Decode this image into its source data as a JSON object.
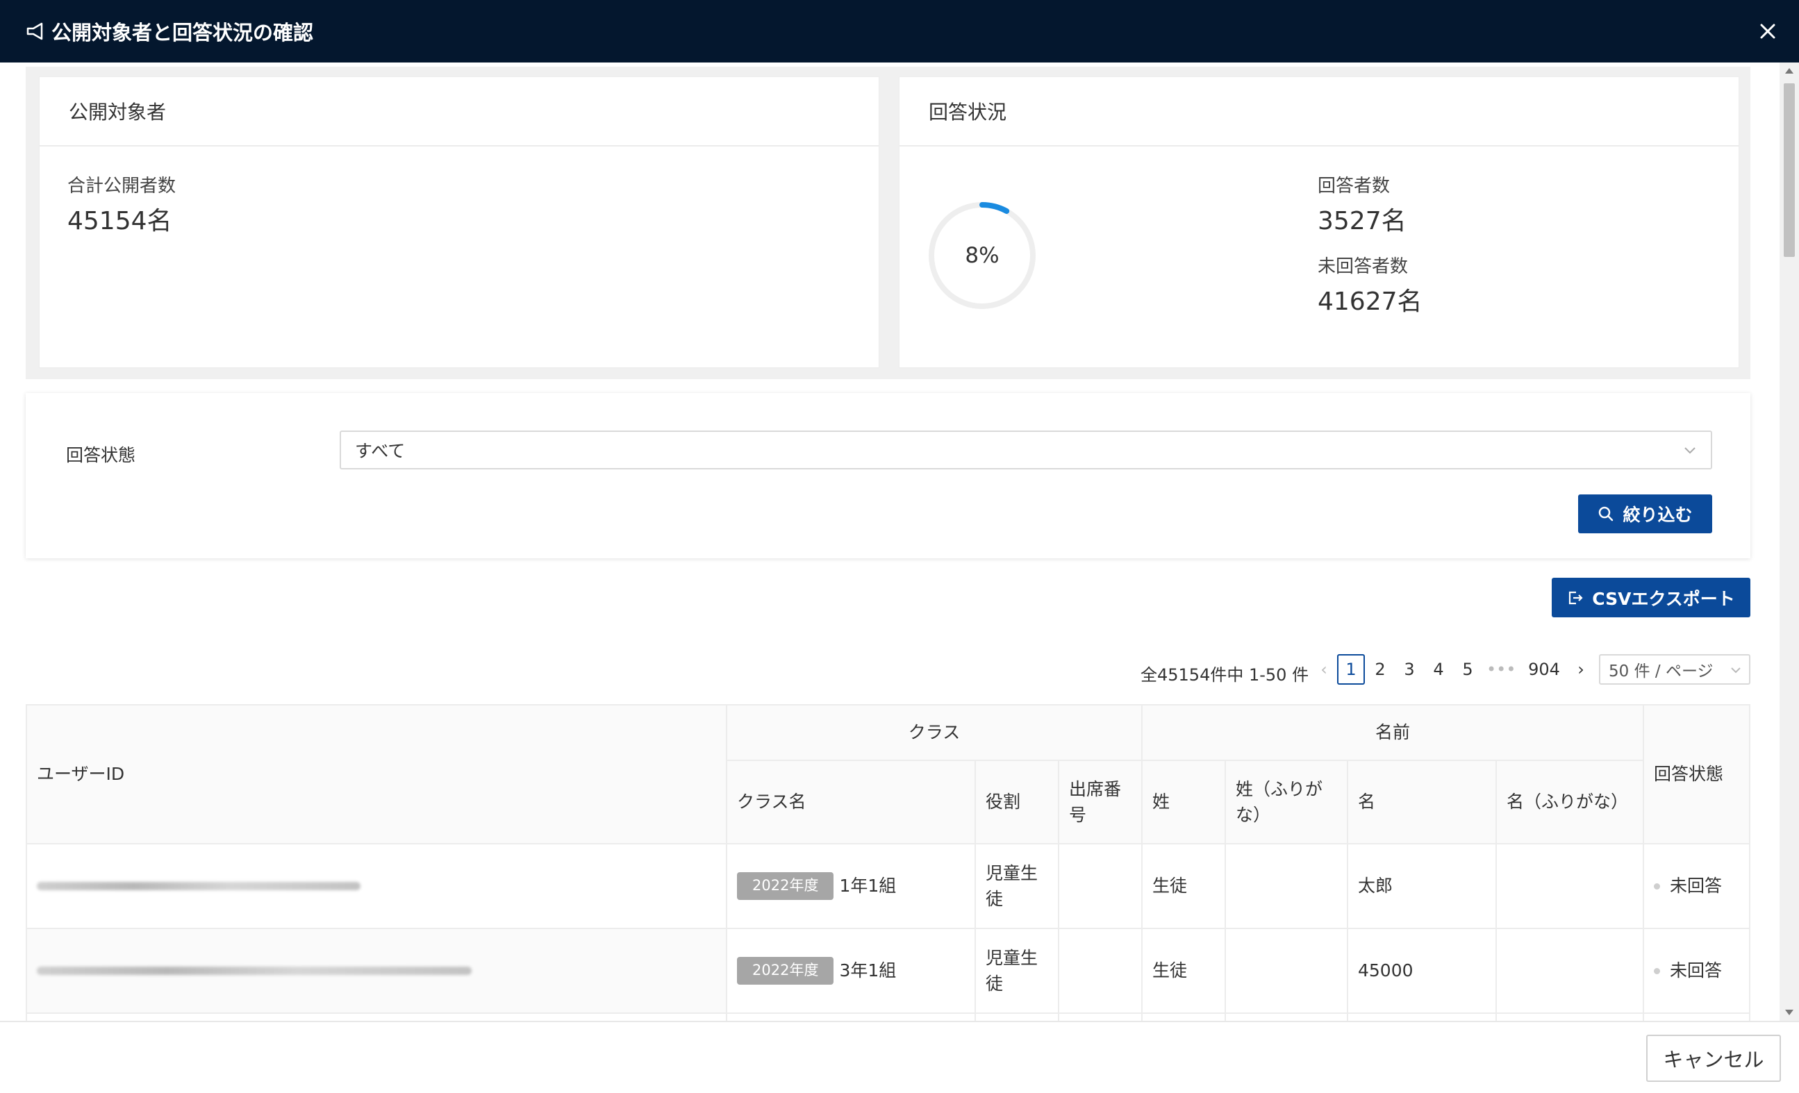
{
  "dialog": {
    "title": "公開対象者と回答状況の確認",
    "close_icon": "close-icon"
  },
  "summary": {
    "target_card": {
      "heading": "公開対象者",
      "total_label": "合計公開者数",
      "total_value": "45154名"
    },
    "status_card": {
      "heading": "回答状況",
      "percent_label": "8%",
      "percent_value": 8,
      "respondents_label": "回答者数",
      "respondents_value": "3527名",
      "non_respondents_label": "未回答者数",
      "non_respondents_value": "41627名"
    }
  },
  "filter": {
    "label": "回答状態",
    "selected": "すべて",
    "button_label": "絞り込む"
  },
  "export": {
    "button_label": "CSVエクスポート"
  },
  "pagination": {
    "total_text": "全45154件中 1-50 件",
    "pages": [
      "1",
      "2",
      "3",
      "4",
      "5"
    ],
    "ellipsis": "•••",
    "last_page": "904",
    "page_size": "50 件 / ページ"
  },
  "table": {
    "headers": {
      "user_id": "ユーザーID",
      "class_group": "クラス",
      "class_name": "クラス名",
      "role": "役割",
      "attendance_no": "出席番号",
      "name_group": "名前",
      "last_name": "姓",
      "last_name_kana": "姓（ふりがな）",
      "first_name": "名",
      "first_name_kana": "名（ふりがな）",
      "status": "回答状態"
    },
    "rows": [
      {
        "year_tag": "2022年度",
        "class_name": "1年1組",
        "role": "児童生徒",
        "attendance_no": "",
        "last_name": "生徒",
        "last_name_kana": "",
        "first_name": "太郎",
        "first_name_kana": "",
        "status": "未回答"
      },
      {
        "year_tag": "2022年度",
        "class_name": "3年1組",
        "role": "児童生徒",
        "attendance_no": "",
        "last_name": "生徒",
        "last_name_kana": "",
        "first_name": "45000",
        "first_name_kana": "",
        "status": "未回答"
      }
    ]
  },
  "footer": {
    "cancel_label": "キャンセル"
  },
  "colors": {
    "titlebar": "#04172e",
    "primary": "#0b4a9a",
    "donut_progress": "#1a8be0",
    "donut_track": "#eeeeee"
  }
}
